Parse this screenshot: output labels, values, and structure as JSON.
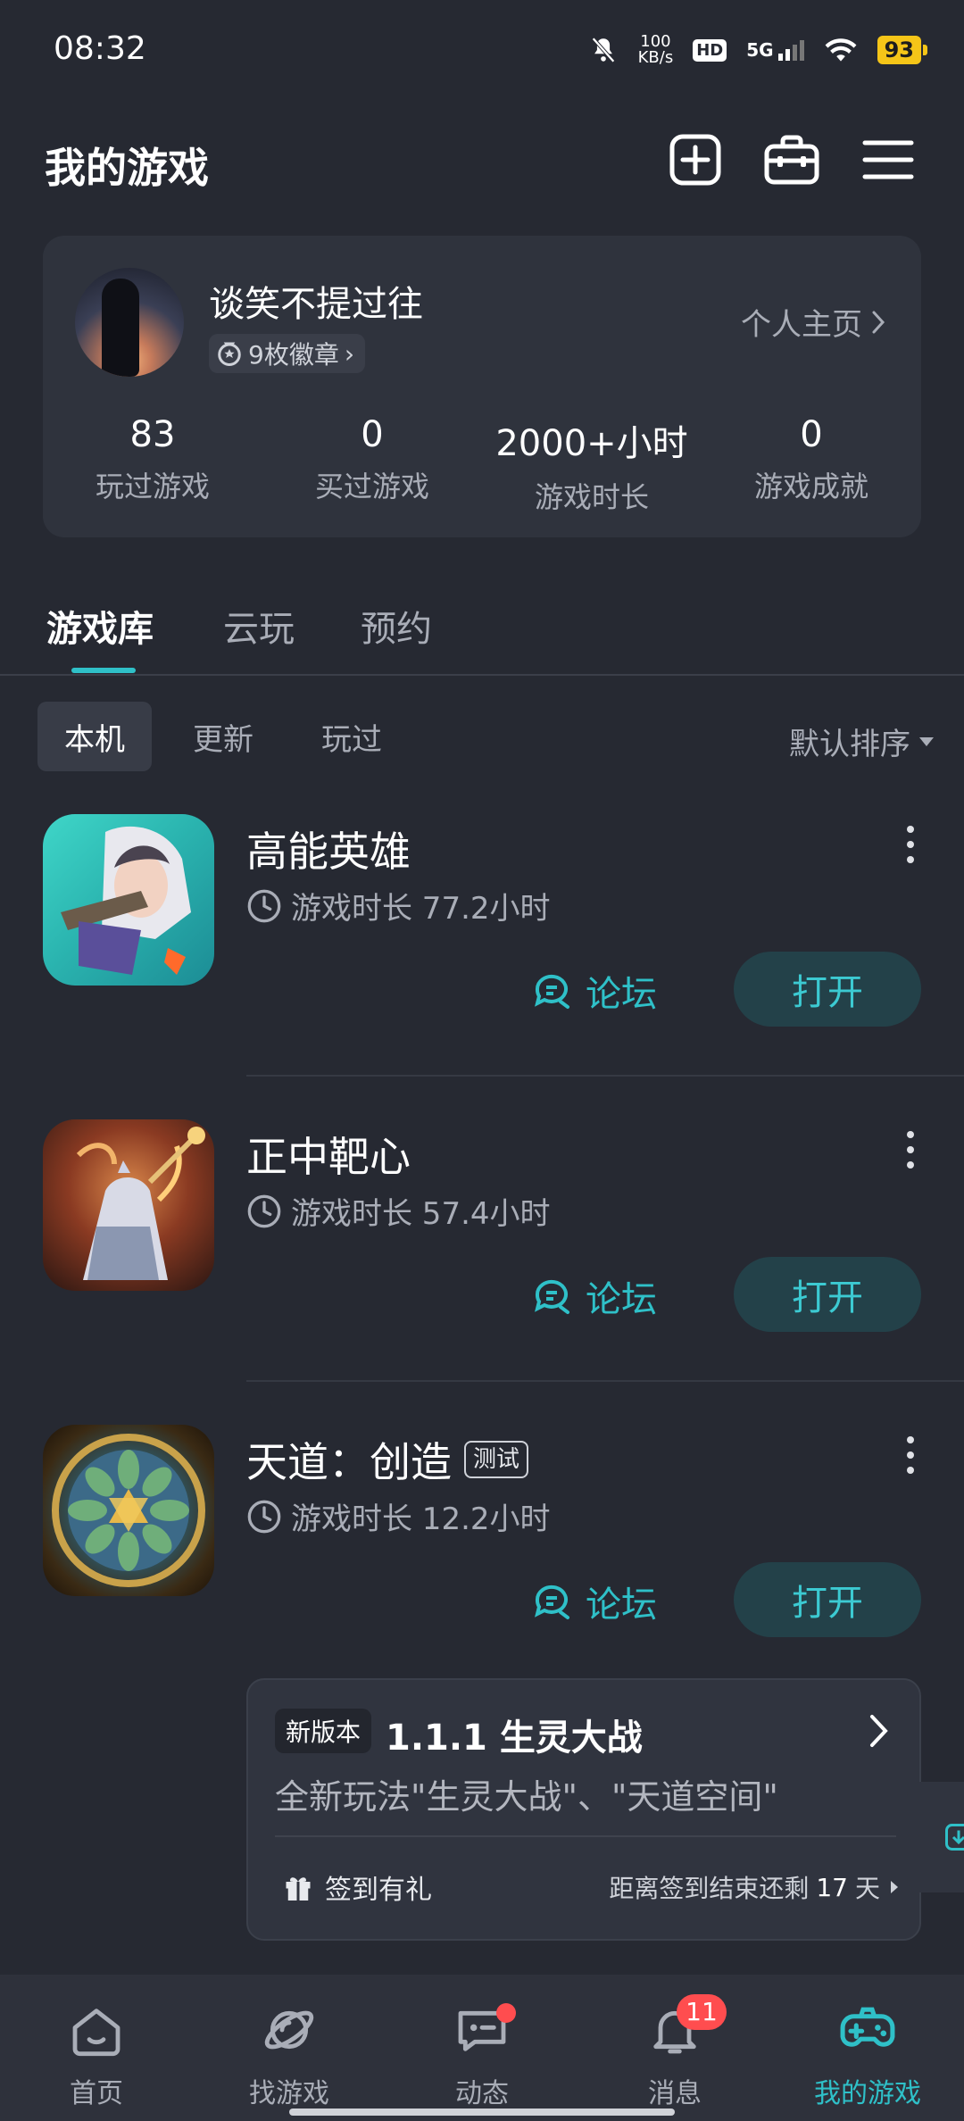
{
  "status_bar": {
    "time": "08:32",
    "speed": "100",
    "speed_unit": "KB/s",
    "hd": "HD",
    "network": "5G",
    "battery": "93"
  },
  "header": {
    "title": "我的游戏"
  },
  "profile": {
    "username": "谈笑不提过往",
    "badges": "9枚徽章",
    "profile_link": "个人主页",
    "stats": [
      {
        "value": "83",
        "label": "玩过游戏"
      },
      {
        "value": "0",
        "label": "买过游戏"
      },
      {
        "value": "2000+小时",
        "label": "游戏时长"
      },
      {
        "value": "0",
        "label": "游戏成就"
      }
    ]
  },
  "tabs": [
    "游戏库",
    "云玩",
    "预约"
  ],
  "filters": [
    "本机",
    "更新",
    "玩过"
  ],
  "sort_label": "默认排序",
  "games": [
    {
      "name": "高能英雄",
      "playtime": "游戏时长 77.2小时",
      "forum": "论坛",
      "open": "打开",
      "test_badge": ""
    },
    {
      "name": "正中靶心",
      "playtime": "游戏时长 57.4小时",
      "forum": "论坛",
      "open": "打开",
      "test_badge": ""
    },
    {
      "name": "天道：创造",
      "playtime": "游戏时长 12.2小时",
      "forum": "论坛",
      "open": "打开",
      "test_badge": "测试"
    }
  ],
  "update_card": {
    "tag": "新版本",
    "title": "1.1.1 生灵大战",
    "description": "全新玩法\"生灵大战\"、\"天道空间\"",
    "checkin": "签到有礼",
    "remaining_prefix": "距离签到结束还剩",
    "remaining_value": "17",
    "remaining_unit": "天"
  },
  "bottom_nav": [
    {
      "label": "首页"
    },
    {
      "label": "找游戏"
    },
    {
      "label": "动态"
    },
    {
      "label": "消息",
      "badge": "11"
    },
    {
      "label": "我的游戏"
    }
  ],
  "colors": {
    "background": "#262932",
    "card": "#2f333d",
    "accent": "#2fc0c8",
    "badge": "#ff4d4f",
    "battery": "#f5c518"
  }
}
